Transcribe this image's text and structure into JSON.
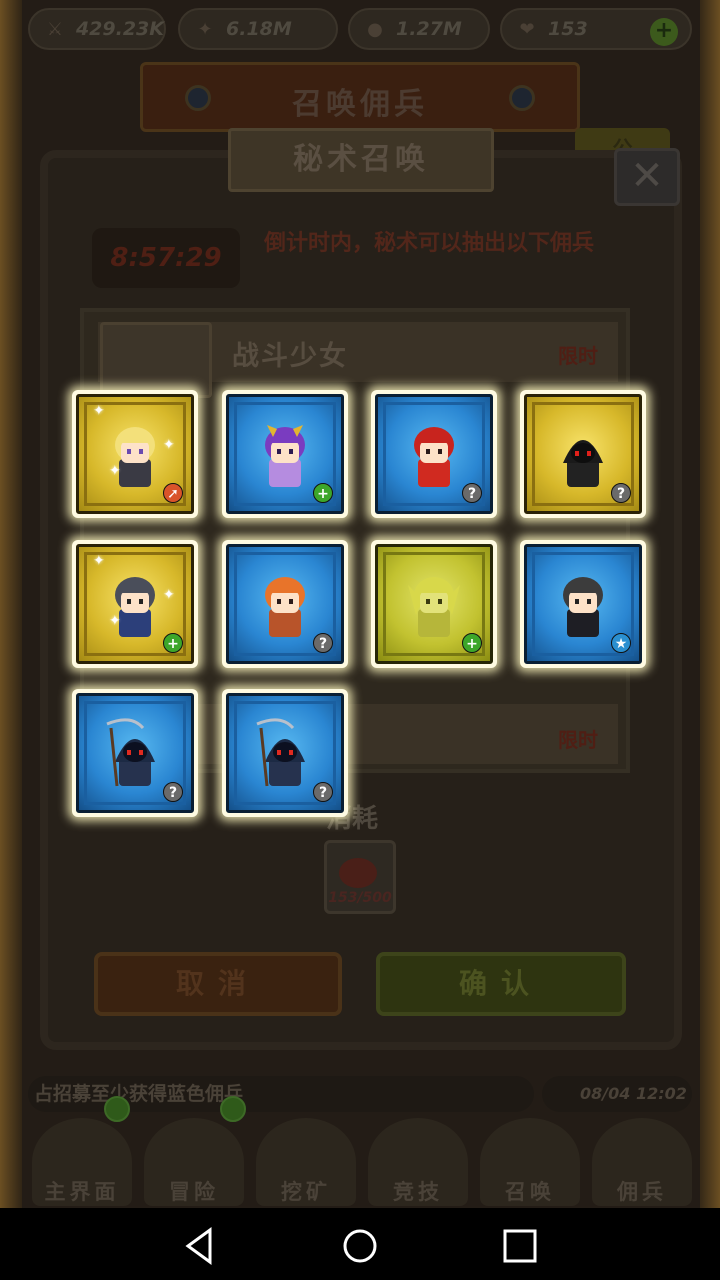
{
  "resources": {
    "gold": "429.23K",
    "exp": "6.18M",
    "food": "1.27M",
    "meat": "153",
    "gold_icon": "sword-icon",
    "exp_icon": "exp-icon",
    "food_icon": "bread-icon",
    "meat_icon": "meat-icon"
  },
  "header": {
    "title": "召唤佣兵"
  },
  "dialog": {
    "title": "秘术召唤",
    "timer": "8:57:29",
    "description": "倒计时内，秘术可以抽出以下佣兵",
    "rows": [
      {
        "name": "战斗少女",
        "tag": "限时"
      },
      {
        "name": "",
        "tag": "限时"
      }
    ],
    "cost_label": "消耗",
    "cost_count": "153/500",
    "cancel": "取消",
    "confirm": "确认"
  },
  "ticker": {
    "text": "占招募至少获得蓝色佣兵",
    "time": "08/04 12:02"
  },
  "nav": {
    "items": [
      {
        "label": "主界面",
        "icon": "map-icon"
      },
      {
        "label": "冒险",
        "icon": "tree-icon"
      },
      {
        "label": "挖矿",
        "icon": "pickaxe-icon"
      },
      {
        "label": "竞技",
        "icon": "crossed-swords-icon"
      },
      {
        "label": "召唤",
        "icon": "scroll-icon"
      },
      {
        "label": "佣兵",
        "icon": "tent-icon"
      }
    ]
  },
  "heroes": [
    {
      "rarity": "gold",
      "sprite": "blonde-girl",
      "badge": "arrow",
      "sparkle": true
    },
    {
      "rarity": "blue",
      "sprite": "purple-witch",
      "badge": "plus",
      "sparkle": false
    },
    {
      "rarity": "blue",
      "sprite": "red-hair-boy",
      "badge": "help",
      "sparkle": false
    },
    {
      "rarity": "gold",
      "sprite": "shadow-hood",
      "badge": "help",
      "sparkle": false
    },
    {
      "rarity": "gold",
      "sprite": "blue-scarf-man",
      "badge": "plus",
      "sparkle": true
    },
    {
      "rarity": "blue",
      "sprite": "fire-maiden",
      "badge": "help",
      "sparkle": false
    },
    {
      "rarity": "yellow",
      "sprite": "golden-dragon",
      "badge": "plus",
      "sparkle": false
    },
    {
      "rarity": "blue",
      "sprite": "dark-cloak",
      "badge": "star",
      "sparkle": false
    },
    {
      "rarity": "blue",
      "sprite": "reaper",
      "badge": "help",
      "sparkle": false
    },
    {
      "rarity": "blue",
      "sprite": "reaper",
      "badge": "help",
      "sparkle": false
    }
  ],
  "colors": {
    "gold_card": "#d7b82a",
    "blue_card": "#2a86d2",
    "yellow_card": "#c2c230",
    "card_glow": "#fff8be",
    "badge_plus": "#3da62a",
    "badge_help": "#6a6a6a"
  }
}
